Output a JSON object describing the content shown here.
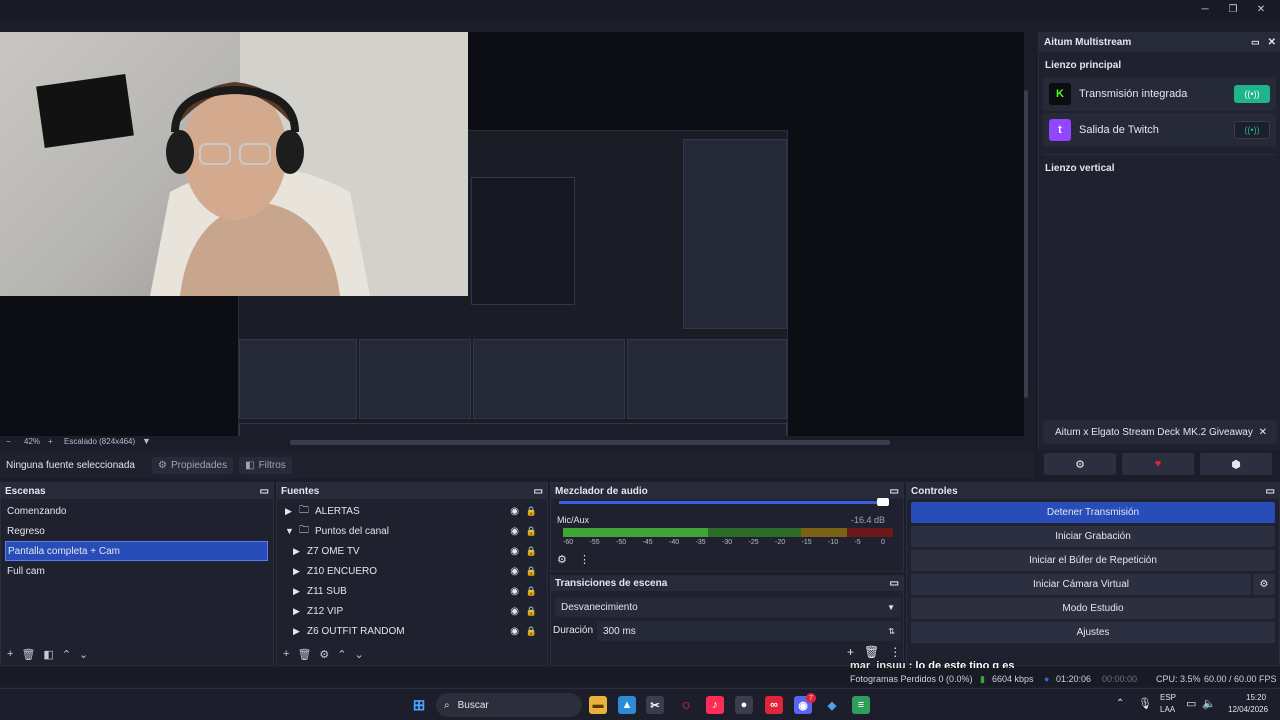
{
  "window": {
    "minimize": "─",
    "maximize": "❐",
    "close": "✕"
  },
  "dock": {
    "title": "Aitum Multistream",
    "main_canvas": "Lienzo principal",
    "destinations": [
      {
        "label": "Transmisión integrada",
        "logo": "K",
        "logo_color": "#53fc18",
        "toggle_color": "#1fb58c",
        "icon": "broadcast-icon"
      },
      {
        "label": "Salida de Twitch",
        "logo": "t",
        "logo_color": "#9146ff",
        "toggle_color": "#262938",
        "icon": "broadcast-icon"
      }
    ],
    "vertical_canvas": "Lienzo vertical",
    "giveaway": "Aitum x Elgato Stream Deck MK.2 Giveaway",
    "close": "✕"
  },
  "zoom": {
    "level": "42%",
    "scaled": "Escalado (824x464)",
    "minus": "−",
    "plus": "+"
  },
  "sourcebar": {
    "no_source": "Ninguna fuente seleccionada",
    "properties": "Propiedades",
    "filters": "Filtros"
  },
  "scenes": {
    "title": "Escenas",
    "items": [
      "Comenzando",
      "Regreso",
      "Pantalla completa + Cam",
      "Full cam"
    ],
    "selected": 2
  },
  "sources": {
    "title": "Fuentes",
    "items": [
      {
        "label": "ALERTAS",
        "indent": 0,
        "folder": true
      },
      {
        "label": "Puntos del  canal",
        "indent": 0,
        "folder": true,
        "open": true
      },
      {
        "label": "Z7 OME TV",
        "indent": 1
      },
      {
        "label": "Z10 ENCUERO",
        "indent": 1
      },
      {
        "label": "Z11 SUB",
        "indent": 1
      },
      {
        "label": "Z12 VIP",
        "indent": 1
      },
      {
        "label": "Z6 OUTFIT RANDOM",
        "indent": 1
      }
    ]
  },
  "mixer": {
    "title": "Mezclador de audio",
    "channel": "Mic/Aux",
    "db": "-16.4 dB",
    "level": 0.44,
    "ticks": [
      "-60",
      "-55",
      "-50",
      "-45",
      "-40",
      "-35",
      "-30",
      "-25",
      "-20",
      "-15",
      "-10",
      "-5",
      "0"
    ]
  },
  "transitions": {
    "title": "Transiciones de escena",
    "selected": "Desvanecimiento",
    "duration_label": "Duración",
    "duration": "300 ms"
  },
  "controls": {
    "title": "Controles",
    "buttons": [
      "Detener Transmisión",
      "Iniciar Grabación",
      "Iniciar el Búfer de Repetición",
      "Iniciar Cámara Virtual",
      "Modo Estudio",
      "Ajustes"
    ]
  },
  "chat": {
    "user": "mar_insuu",
    "message": " : lo de este tipo q es"
  },
  "status": {
    "dropped": "Fotogramas Perdidos 0 (0.0%)",
    "kbps": "6604 kbps",
    "live_time": "01:20:06",
    "rec_time": "00:00:00",
    "cpu": "CPU: 3.5%",
    "fps": "60.00 / 60.00 FPS"
  },
  "taskbar": {
    "search": "Buscar",
    "lang_top": "ESP",
    "lang_bottom": "LAA",
    "time": "15:20",
    "date": "12/04/2026",
    "badge": "7"
  },
  "colors": {
    "accent": "#284cb8",
    "meter_green": "#3fa535",
    "meter_yellow": "#c8a427",
    "meter_red": "#b32a2a"
  }
}
